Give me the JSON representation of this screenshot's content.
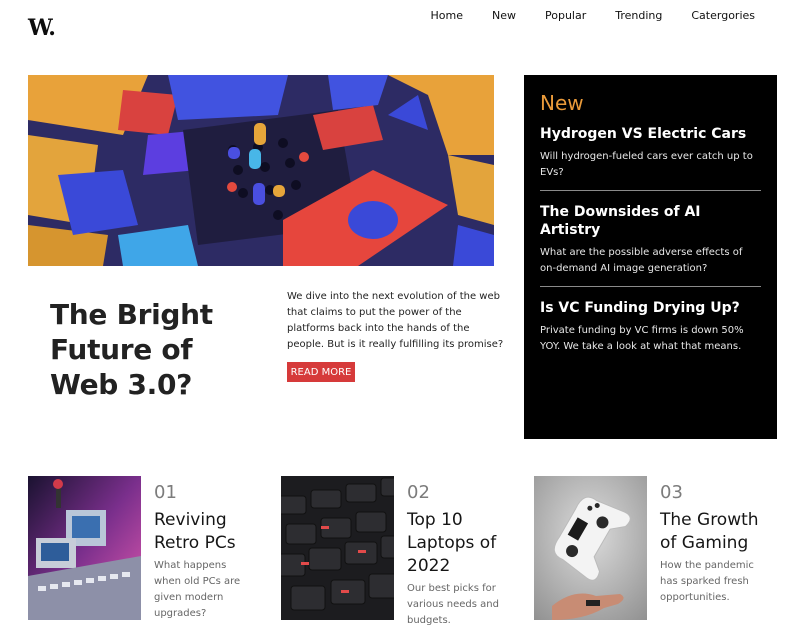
{
  "logo": "W.",
  "nav": [
    "Home",
    "New",
    "Popular",
    "Trending",
    "Catergories"
  ],
  "hero": {
    "title": "The Bright Future of Web 3.0?",
    "description": "We dive into the next evolution of the web that claims to put the power of the platforms back into the hands of the people. But is it really fulfilling its promise?",
    "button": "READ MORE"
  },
  "new_panel": {
    "heading": "New",
    "items": [
      {
        "title": "Hydrogen VS Electric Cars",
        "desc": "Will hydrogen-fueled cars ever catch up to EVs?"
      },
      {
        "title": "The Downsides of AI Artistry",
        "desc": "What are the possible adverse effects of on-demand AI image generation?"
      },
      {
        "title": "Is VC Funding Drying Up?",
        "desc": "Private funding by VC firms is down 50% YOY. We take a look at what that means."
      }
    ]
  },
  "cards": [
    {
      "number": "01",
      "title": "Reviving Retro PCs",
      "desc": "What happens when old PCs are given modern upgrades?"
    },
    {
      "number": "02",
      "title": "Top 10 Laptops of 2022",
      "desc": "Our best picks for various needs and budgets."
    },
    {
      "number": "03",
      "title": "The Growth of Gaming",
      "desc": "How the pandemic has sparked fresh opportunities."
    }
  ],
  "colors": {
    "accent_orange": "#e99a3a",
    "button_red": "#d63a3a",
    "panel_bg": "#000000"
  }
}
